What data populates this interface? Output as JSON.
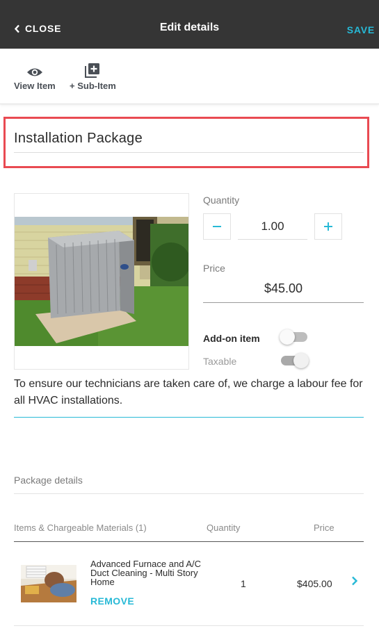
{
  "header": {
    "close_label": "CLOSE",
    "title": "Edit details",
    "save_label": "SAVE",
    "background": "#353535",
    "accent": "#27b9d6"
  },
  "toolbar": {
    "view_item_label": "View Item",
    "sub_item_label": "+ Sub-Item",
    "view_icon": "eye-icon",
    "sub_icon": "add-layers-icon"
  },
  "item": {
    "name": "Installation Package",
    "image": "air-conditioner-unit-photo",
    "quantity_label": "Quantity",
    "quantity": "1.00",
    "price_label": "Price",
    "price": "$45.00",
    "addon_label": "Add-on item",
    "addon_on": false,
    "taxable_label": "Taxable",
    "taxable_on": true,
    "description": "To ensure our technicians are taken care of, we charge a labour fee for all HVAC installations."
  },
  "package": {
    "section_label": "Package details",
    "columns": {
      "items": "Items & Chargeable Materials (1)",
      "quantity": "Quantity",
      "price": "Price"
    },
    "rows": [
      {
        "name": "Advanced Furnace and A/C Duct Cleaning - Multi Story Home",
        "quantity": "1",
        "price": "$405.00",
        "remove_label": "REMOVE",
        "thumbnail": "duct-cleaning-photo"
      }
    ]
  },
  "highlight_color": "#e94a52"
}
